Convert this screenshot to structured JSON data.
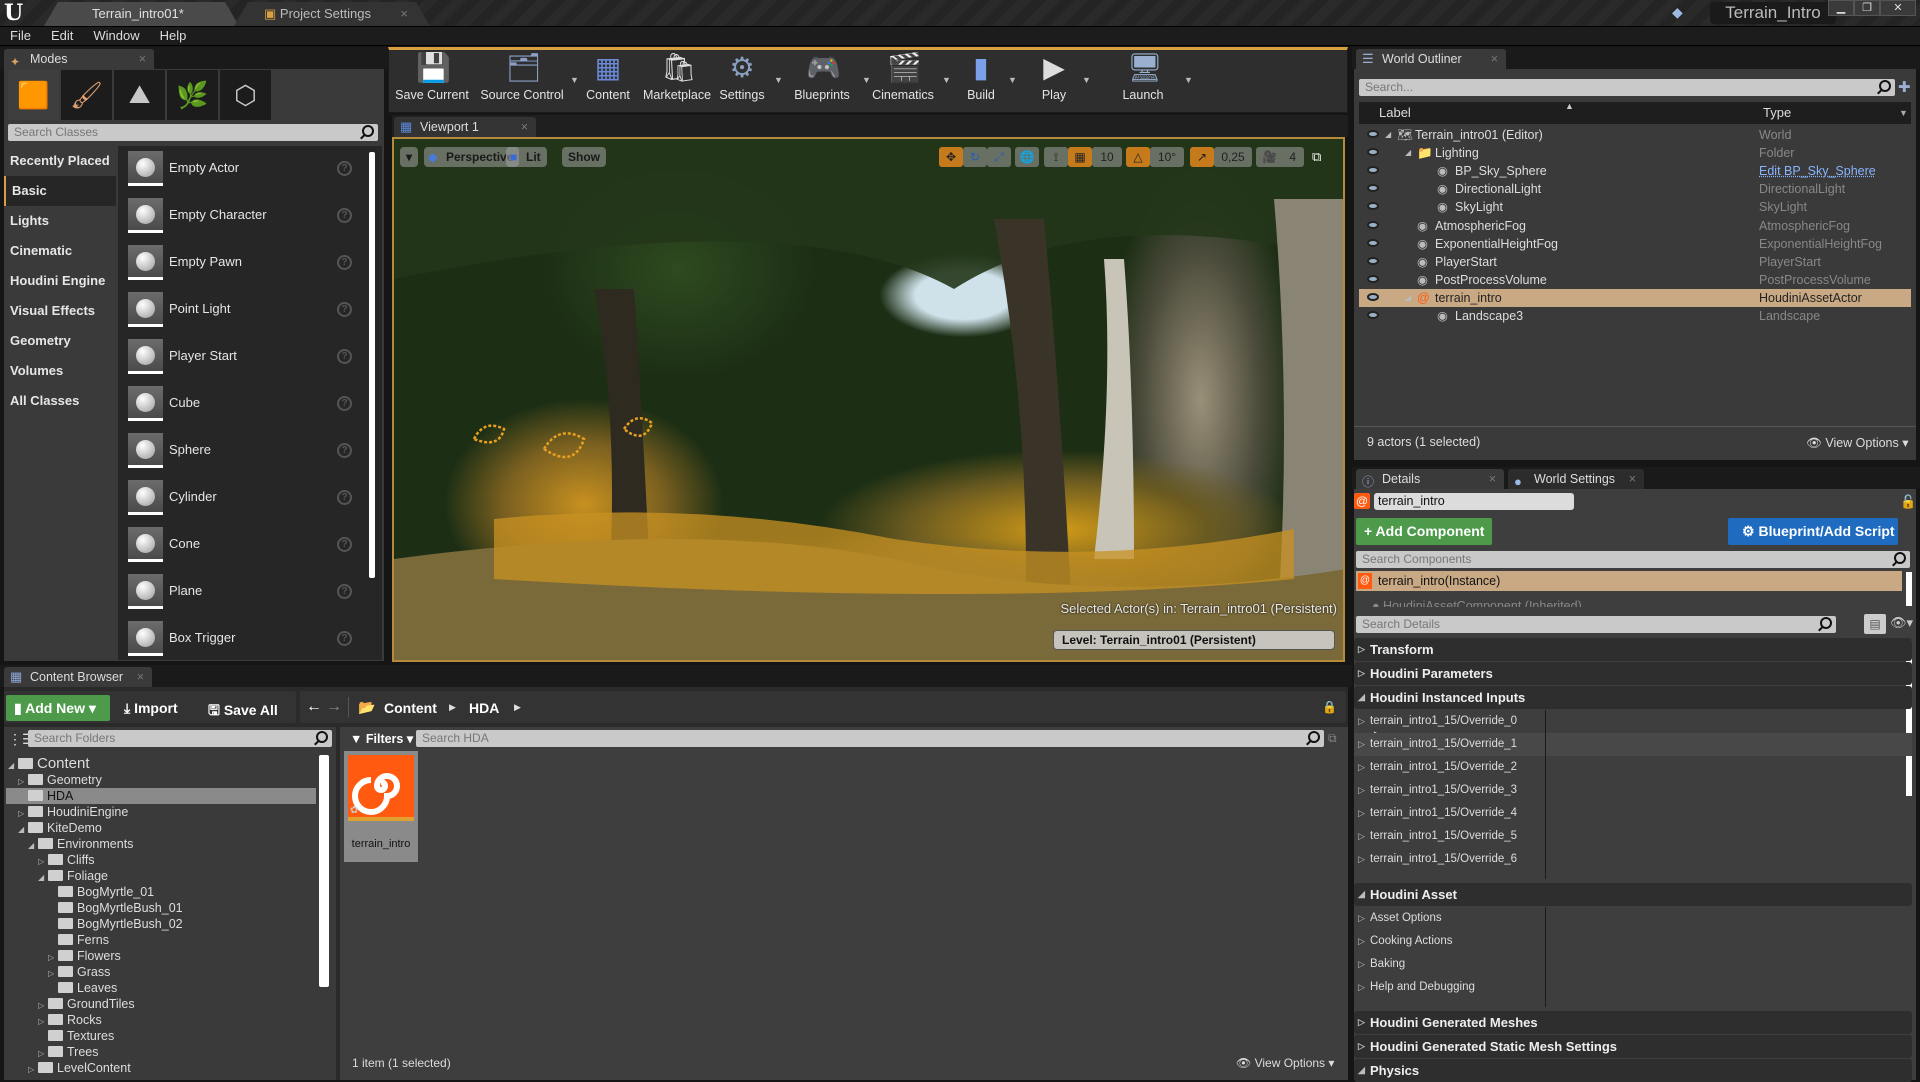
{
  "window": {
    "tabs": [
      {
        "label": "Terrain_intro01*",
        "active": true
      },
      {
        "label": "Project Settings",
        "active": false
      }
    ],
    "project_name": "Terrain_Intro",
    "controls": {
      "minimize": "▁",
      "maximize": "❐",
      "close": "✕"
    }
  },
  "menu": [
    "File",
    "Edit",
    "Window",
    "Help"
  ],
  "modes": {
    "tab_label": "Modes",
    "mode_icons": [
      "place-mode-icon",
      "paint-mode-icon",
      "landscape-mode-icon",
      "foliage-mode-icon",
      "geometry-mode-icon"
    ],
    "search_placeholder": "Search Classes",
    "categories": [
      "Recently Placed",
      "Basic",
      "Lights",
      "Cinematic",
      "Houdini Engine",
      "Visual Effects",
      "Geometry",
      "Volumes",
      "All Classes"
    ],
    "selected_category": "Basic",
    "items": [
      "Empty Actor",
      "Empty Character",
      "Empty Pawn",
      "Point Light",
      "Player Start",
      "Cube",
      "Sphere",
      "Cylinder",
      "Cone",
      "Plane",
      "Box Trigger"
    ]
  },
  "toolbar": {
    "buttons": [
      {
        "label": "Save Current",
        "icon": "save-icon",
        "dropdown": false
      },
      {
        "label": "Source Control",
        "icon": "source-control-icon",
        "dropdown": true
      },
      {
        "label": "Content",
        "icon": "content-icon",
        "dropdown": false
      },
      {
        "label": "Marketplace",
        "icon": "marketplace-icon",
        "dropdown": false
      },
      {
        "label": "Settings",
        "icon": "settings-icon",
        "dropdown": true
      },
      {
        "label": "Blueprints",
        "icon": "blueprints-icon",
        "dropdown": true
      },
      {
        "label": "Cinematics",
        "icon": "cinematics-icon",
        "dropdown": true
      },
      {
        "label": "Build",
        "icon": "build-icon",
        "dropdown": true
      },
      {
        "label": "Play",
        "icon": "play-icon",
        "dropdown": true
      },
      {
        "label": "Launch",
        "icon": "launch-icon",
        "dropdown": true
      }
    ]
  },
  "viewport": {
    "tab_label": "Viewport 1",
    "view_mode": "Perspective",
    "lighting": "Lit",
    "show_label": "Show",
    "grid_snap": "10",
    "rotation_snap": "10°",
    "scale_snap": "0,25",
    "camera_speed": "4",
    "selected_actor_text": "Selected Actor(s) in:  Terrain_intro01 (Persistent)",
    "level_text": "Level:  Terrain_intro01 (Persistent)"
  },
  "outliner": {
    "tab_label": "World Outliner",
    "search_placeholder": "Search...",
    "columns": [
      "Label",
      "Type"
    ],
    "rows": [
      {
        "label": "Terrain_intro01 (Editor)",
        "type": "World",
        "depth": 0,
        "expanded": true
      },
      {
        "label": "Lighting",
        "type": "Folder",
        "depth": 1,
        "expanded": true
      },
      {
        "label": "BP_Sky_Sphere",
        "type": "Edit BP_Sky_Sphere",
        "depth": 2,
        "link": true
      },
      {
        "label": "DirectionalLight",
        "type": "DirectionalLight",
        "depth": 2
      },
      {
        "label": "SkyLight",
        "type": "SkyLight",
        "depth": 2
      },
      {
        "label": "AtmosphericFog",
        "type": "AtmosphericFog",
        "depth": 1
      },
      {
        "label": "ExponentialHeightFog",
        "type": "ExponentialHeightFog",
        "depth": 1
      },
      {
        "label": "PlayerStart",
        "type": "PlayerStart",
        "depth": 1
      },
      {
        "label": "PostProcessVolume",
        "type": "PostProcessVolume",
        "depth": 1
      },
      {
        "label": "terrain_intro",
        "type": "HoudiniAssetActor",
        "depth": 1,
        "expanded": true,
        "selected": true
      },
      {
        "label": "Landscape3",
        "type": "Landscape",
        "depth": 2
      }
    ],
    "status": "9 actors (1 selected)",
    "view_options": "View Options"
  },
  "details": {
    "tabs": [
      "Details",
      "World Settings"
    ],
    "actor_name": "terrain_intro",
    "add_component": "Add Component",
    "blueprint_button": "Blueprint/Add Script",
    "search_components_placeholder": "Search Components",
    "components": [
      "terrain_intro(Instance)",
      "HoudiniAssetComponent (Inherited)"
    ],
    "search_details_placeholder": "Search Details",
    "categories": [
      {
        "label": "Transform",
        "expanded": false
      },
      {
        "label": "Houdini Parameters",
        "expanded": false
      },
      {
        "label": "Houdini Instanced Inputs",
        "expanded": true,
        "children": [
          "terrain_intro1_15/Override_0",
          "terrain_intro1_15/Override_1",
          "terrain_intro1_15/Override_2",
          "terrain_intro1_15/Override_3",
          "terrain_intro1_15/Override_4",
          "terrain_intro1_15/Override_5",
          "terrain_intro1_15/Override_6"
        ]
      },
      {
        "label": "Houdini Asset",
        "expanded": true,
        "children": [
          "Asset Options",
          "Cooking Actions",
          "Baking",
          "Help and Debugging"
        ]
      },
      {
        "label": "Houdini Generated Meshes",
        "expanded": false
      },
      {
        "label": "Houdini Generated Static Mesh Settings",
        "expanded": false
      },
      {
        "label": "Physics",
        "expanded": true
      }
    ]
  },
  "content_browser": {
    "tab_label": "Content Browser",
    "add_new": "Add New",
    "import": "Import",
    "save_all": "Save All",
    "breadcrumb": [
      "Content",
      "HDA"
    ],
    "search_folders_placeholder": "Search Folders",
    "filters": "Filters",
    "search_assets_placeholder": "Search HDA",
    "tree": [
      {
        "label": "Content",
        "depth": 0,
        "arrow": "open"
      },
      {
        "label": "Geometry",
        "depth": 1,
        "arrow": "closed"
      },
      {
        "label": "HDA",
        "depth": 1,
        "arrow": "none",
        "selected": true
      },
      {
        "label": "HoudiniEngine",
        "depth": 1,
        "arrow": "closed"
      },
      {
        "label": "KiteDemo",
        "depth": 1,
        "arrow": "open"
      },
      {
        "label": "Environments",
        "depth": 2,
        "arrow": "open"
      },
      {
        "label": "Cliffs",
        "depth": 3,
        "arrow": "closed"
      },
      {
        "label": "Foliage",
        "depth": 3,
        "arrow": "open"
      },
      {
        "label": "BogMyrtle_01",
        "depth": 4,
        "arrow": "none"
      },
      {
        "label": "BogMyrtleBush_01",
        "depth": 4,
        "arrow": "none"
      },
      {
        "label": "BogMyrtleBush_02",
        "depth": 4,
        "arrow": "none"
      },
      {
        "label": "Ferns",
        "depth": 4,
        "arrow": "none"
      },
      {
        "label": "Flowers",
        "depth": 4,
        "arrow": "closed"
      },
      {
        "label": "Grass",
        "depth": 4,
        "arrow": "closed"
      },
      {
        "label": "Leaves",
        "depth": 4,
        "arrow": "none"
      },
      {
        "label": "GroundTiles",
        "depth": 3,
        "arrow": "closed"
      },
      {
        "label": "Rocks",
        "depth": 3,
        "arrow": "closed"
      },
      {
        "label": "Textures",
        "depth": 3,
        "arrow": "none"
      },
      {
        "label": "Trees",
        "depth": 3,
        "arrow": "closed"
      },
      {
        "label": "LevelContent",
        "depth": 2,
        "arrow": "closed"
      }
    ],
    "assets": [
      {
        "label": "terrain_intro",
        "icon": "houdini-asset-icon"
      }
    ],
    "status": "1 item (1 selected)",
    "view_options": "View Options"
  },
  "colors": {
    "accent_orange": "#c57a1c",
    "selection_tan": "#c9a984",
    "add_green": "#4c9a4a",
    "blueprint_blue": "#1e6bbf",
    "houdini_orange": "#ff5a10",
    "link_blue": "#88b4ff"
  }
}
